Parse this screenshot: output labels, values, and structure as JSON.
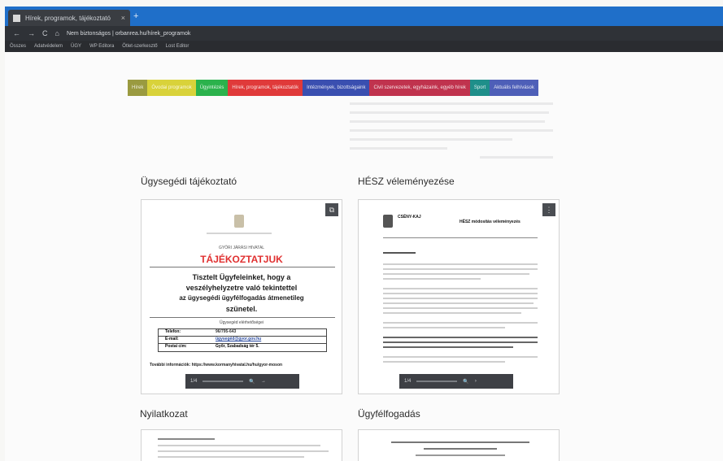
{
  "browser": {
    "tab_title": "Hírek, programok, tájékoztató",
    "tab_close": "×",
    "new_tab": "+",
    "nav_icons": [
      "←",
      "→",
      "C",
      "⌂"
    ],
    "url_text": "Nem biztonságos | ",
    "url_domain": "orbanrea.hu",
    "url_path": "/hírek_programok",
    "bookmarks": [
      "Összes",
      "Adatvédelem",
      "ÜGY",
      "WP Editora",
      "Ötlet-szerkesztő",
      "Lost Editor"
    ]
  },
  "site_nav": [
    {
      "label": "Hírek",
      "color": "#9a9a40"
    },
    {
      "label": "Óvodai programok",
      "color": "#d9d23a"
    },
    {
      "label": "Ügyintézés",
      "color": "#2bb24c"
    },
    {
      "label": "Hírek, programok, tájékoztatók",
      "color": "#e03a3a"
    },
    {
      "label": "Intézmények, bizottságaink",
      "color": "#3a4fb0"
    },
    {
      "label": "Civil szervezetek, egyházaink, egyéb hírek",
      "color": "#c0334e"
    },
    {
      "label": "Sport",
      "color": "#1f8f8a"
    },
    {
      "label": "Aktuális felhívások",
      "color": "#4e5fb8"
    }
  ],
  "sections": {
    "s1": "Ügysegédi tájékoztató",
    "s2": "HÉSZ véleményezése",
    "s3": "Nyilatkozat",
    "s4": "Ügyfélfogadás"
  },
  "doc1": {
    "office": "GYŐRI JÁRÁSI HIVATAL",
    "title": "TÁJÉKOZTATJUK",
    "body_1": "Tisztelt Ügyfeleinket, hogy a",
    "body_2": "veszélyhelyzetre való tekintettel",
    "body_3": "az ügysegédi ügyfélfogadás átmenetileg",
    "body_4": "szünetel.",
    "table_caption": "Ügysegéd elérhetőségei",
    "table_rows": [
      {
        "k": "Telefon:",
        "v": "96/795-643"
      },
      {
        "k": "E-mail:",
        "v": "ügysegéd@gyor.gov.hu"
      },
      {
        "k": "Postai cím:",
        "v": "Győr, Szabadság tér 5."
      }
    ],
    "footer": "További információk: https://www.kormanyhivatal.hu/hu/gyor-moson"
  },
  "doc2": {
    "header_left": "CSÉNY-KAJ",
    "header_right": "HÉSZ módosítás véleményezés"
  },
  "toolbar1": {
    "page": "1/4",
    "search": "🔍",
    "next": "→"
  },
  "toolbar2": {
    "page": "1/4",
    "search": "🔍",
    "next": "›"
  },
  "icons": {
    "open": "open-external-icon",
    "expand": "expand-icon"
  }
}
